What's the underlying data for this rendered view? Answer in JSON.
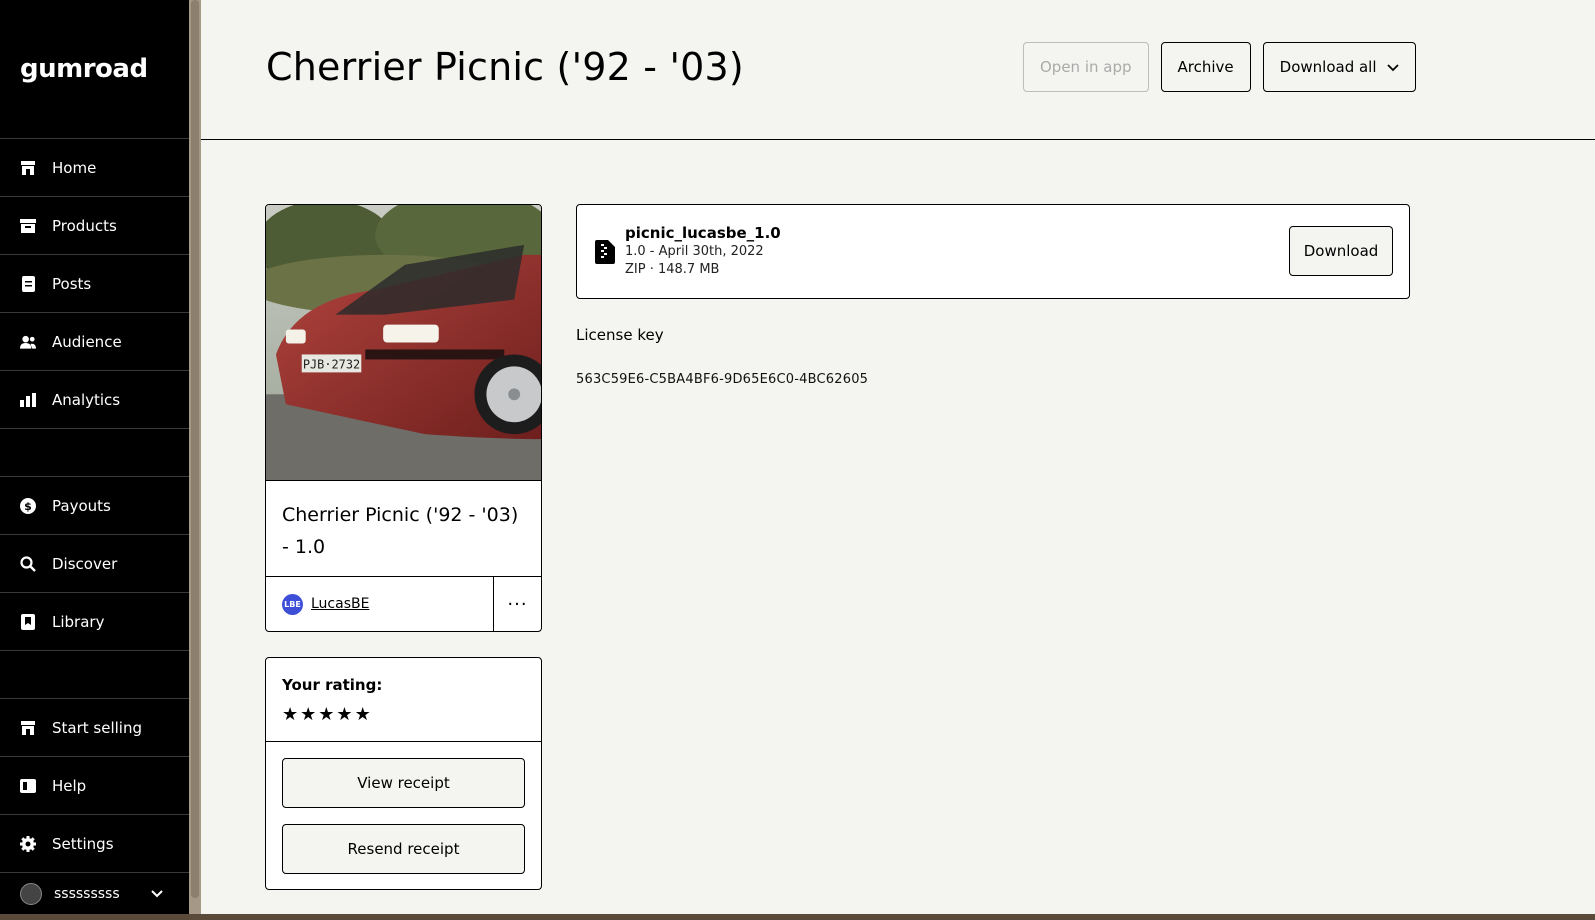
{
  "sidebar": {
    "logo": "GUMroad",
    "items": [
      {
        "label": "Home",
        "icon": "store-icon"
      },
      {
        "label": "Products",
        "icon": "archive-icon"
      },
      {
        "label": "Posts",
        "icon": "document-icon"
      },
      {
        "label": "Audience",
        "icon": "people-icon"
      },
      {
        "label": "Analytics",
        "icon": "bar-chart-icon"
      }
    ],
    "items2": [
      {
        "label": "Payouts",
        "icon": "dollar-icon"
      },
      {
        "label": "Discover",
        "icon": "search-icon"
      },
      {
        "label": "Library",
        "icon": "bookmark-icon"
      }
    ],
    "items3": [
      {
        "label": "Start selling",
        "icon": "store-icon"
      },
      {
        "label": "Help",
        "icon": "book-icon"
      },
      {
        "label": "Settings",
        "icon": "gear-icon"
      }
    ],
    "user": "sssssssss"
  },
  "header": {
    "title": "Cherrier Picnic ('92 - '03)",
    "open_in_app": "Open in app",
    "archive": "Archive",
    "download_all": "Download all"
  },
  "product": {
    "title": "Cherrier Picnic ('92 - '03) - 1.0",
    "creator": "LucasBE",
    "creator_initials": "LBE",
    "more": "···"
  },
  "rating": {
    "label": "Your rating:",
    "stars": 5,
    "view_receipt": "View receipt",
    "resend_receipt": "Resend receipt"
  },
  "file": {
    "name": "picnic_lucasbe_1.0",
    "version": "1.0 - April 30th, 2022",
    "meta": "ZIP · 148.7 MB",
    "download": "Download"
  },
  "license": {
    "label": "License key",
    "key": "563C59E6-C5BA4BF6-9D65E6C0-4BC62605"
  },
  "colors": {
    "background": "#f4f4f0",
    "sidebar": "#000000",
    "creator_avatar": "#3d4fd6"
  }
}
